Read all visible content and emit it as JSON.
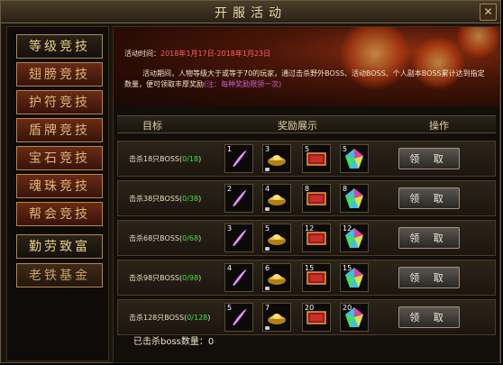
{
  "window": {
    "title": "开服活动",
    "close_label": "✕"
  },
  "sidebar": {
    "items": [
      {
        "label": "等级竞技"
      },
      {
        "label": "翅膀竞技"
      },
      {
        "label": "护符竞技"
      },
      {
        "label": "盾牌竞技"
      },
      {
        "label": "宝石竞技"
      },
      {
        "label": "魂珠竞技"
      },
      {
        "label": "帮会竞技"
      },
      {
        "label": "勤劳致富"
      },
      {
        "label": "老铁基金"
      }
    ]
  },
  "banner": {
    "time_label": "活动时间：",
    "time_range": "2018年1月17日-2018年1月23日",
    "desc": "活动期间，人物等级大于或等于70的玩家，通过击杀野外BOSS、活动BOSS、个人副本BOSS累计达到指定数量，便可领取丰厚奖励",
    "note": "(注：每种奖励限领一次)"
  },
  "table": {
    "headers": {
      "target": "目标",
      "rewards": "奖励展示",
      "action": "操作"
    },
    "claim_label": "领 取",
    "rows": [
      {
        "goal": "击杀18只BOSS",
        "progress": "0/18",
        "qty": [
          "1",
          "3",
          "5",
          "5"
        ]
      },
      {
        "goal": "击杀38只BOSS",
        "progress": "0/38",
        "qty": [
          "2",
          "4",
          "8",
          "8"
        ]
      },
      {
        "goal": "击杀68只BOSS",
        "progress": "0/68",
        "qty": [
          "3",
          "5",
          "12",
          "12"
        ]
      },
      {
        "goal": "击杀98只BOSS",
        "progress": "0/98",
        "qty": [
          "4",
          "6",
          "15",
          "15"
        ]
      },
      {
        "goal": "击杀128只BOSS",
        "progress": "0/128",
        "qty": [
          "5",
          "7",
          "20",
          "20"
        ]
      }
    ]
  },
  "footer": {
    "label": "已击杀boss数量：",
    "value": "0"
  },
  "icons": [
    "purple-feather-icon",
    "gold-ingot-icon",
    "red-book-icon",
    "rainbow-gem-icon"
  ]
}
